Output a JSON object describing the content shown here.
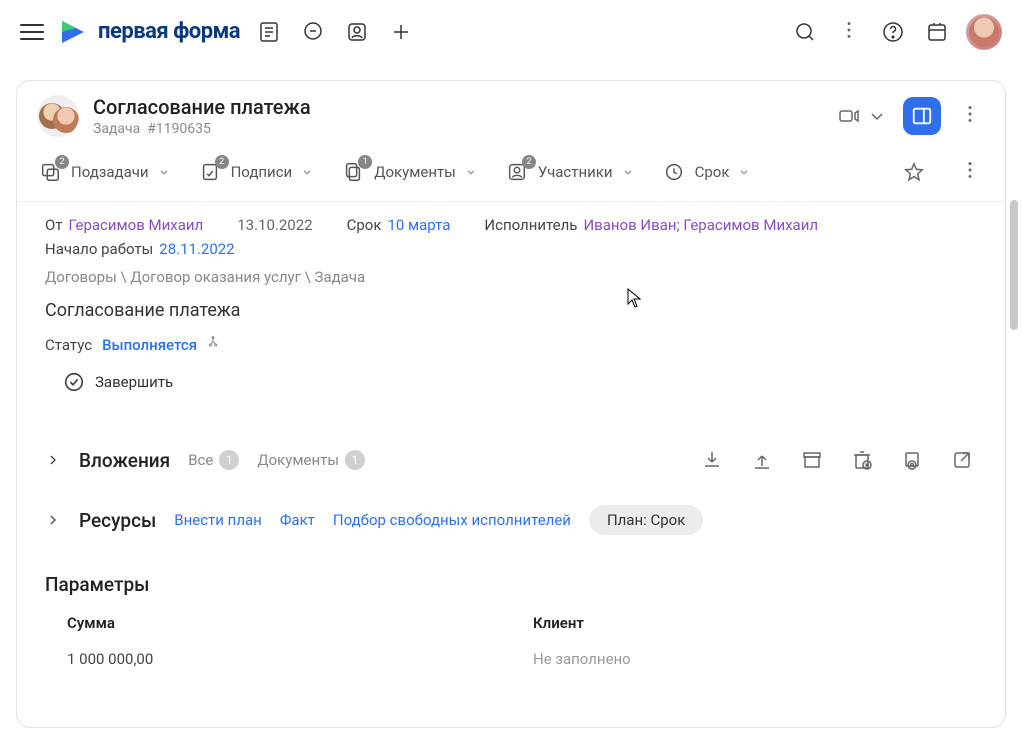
{
  "app": {
    "logo_text": "первая форма"
  },
  "task": {
    "title": "Согласование платежа",
    "subtype": "Задача",
    "number": "#1190635"
  },
  "tabs": [
    {
      "label": "Подзадачи",
      "badge": "2"
    },
    {
      "label": "Подписи",
      "badge": "2"
    },
    {
      "label": "Документы",
      "badge": "1"
    },
    {
      "label": "Участники",
      "badge": "2"
    },
    {
      "label": "Срок",
      "badge": null
    }
  ],
  "meta": {
    "from_label": "От",
    "from_value": "Герасимов Михаил",
    "date": "13.10.2022",
    "deadline_label": "Срок",
    "deadline_value": "10 марта",
    "assignee_label": "Исполнитель",
    "assignee_value": "Иванов Иван; Герасимов Михаил",
    "start_label": "Начало работы",
    "start_value": "28.11.2022"
  },
  "breadcrumbs": "Договоры \\ Договор оказания услуг \\ Задача",
  "main_title": "Согласование платежа",
  "status": {
    "label": "Статус",
    "value": "Выполняется"
  },
  "actions": {
    "complete": "Завершить"
  },
  "attachments": {
    "title": "Вложения",
    "all_label": "Все",
    "all_count": "1",
    "docs_label": "Документы",
    "docs_count": "1"
  },
  "resources": {
    "title": "Ресурсы",
    "links": [
      "Внести план",
      "Факт",
      "Подбор свободных исполнителей"
    ],
    "pill": "План: Срок"
  },
  "params": {
    "title": "Параметры",
    "sum_label": "Сумма",
    "sum_value": "1 000 000,00",
    "client_label": "Клиент",
    "client_value": "Не заполнено"
  }
}
